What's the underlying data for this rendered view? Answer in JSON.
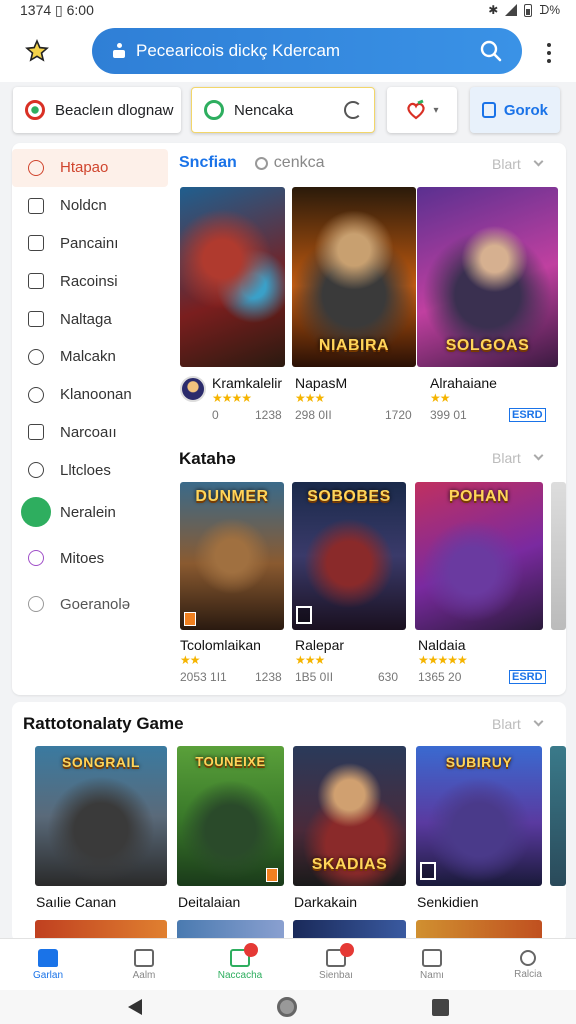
{
  "status_bar": {
    "time": "1374 ▯ 6:00",
    "battery": "ᗪ%"
  },
  "top_bar": {
    "search_query": "Pecearicois dickç Kdercam"
  },
  "chips": [
    {
      "label": "Beacleın dlognaw"
    },
    {
      "label": "Nencaka"
    },
    {
      "label": ""
    },
    {
      "label": "Gorok"
    }
  ],
  "sidebar": {
    "items": [
      {
        "label": "Htapao"
      },
      {
        "label": "Noldcn"
      },
      {
        "label": "Pancainı"
      },
      {
        "label": "Racoinsi"
      },
      {
        "label": "Naltaga"
      },
      {
        "label": "Malcakn"
      },
      {
        "label": "Klanoonan"
      },
      {
        "label": "Narcoaıı"
      },
      {
        "label": "Lltcloes"
      },
      {
        "label": "Neralein"
      },
      {
        "label": "Mitoes"
      },
      {
        "label": "Goeranolə"
      }
    ]
  },
  "section1": {
    "title": "Sncfian",
    "sub": "cenkca",
    "more": "Blart",
    "games": [
      {
        "name": "Kramkalelir",
        "stars": "★★★★",
        "meta_a": "0",
        "meta_b": "1238",
        "art_text": ""
      },
      {
        "name": "NapasM",
        "stars": "★★★",
        "meta_a": "298 0II",
        "meta_b": "1720",
        "art_text": "NIABIRA"
      },
      {
        "name": "Alrahaiane",
        "stars": "★★",
        "meta_a": "399 01",
        "esrb": "ESRD",
        "art_text": "SOLGOAS"
      }
    ]
  },
  "section2": {
    "title": "Katahə",
    "more": "Blart",
    "games": [
      {
        "name": "Tcolomlaikan",
        "stars": "★★",
        "meta_a": "2053 1I1",
        "meta_b": "1238",
        "art_text": "DUNMER"
      },
      {
        "name": "Ralepar",
        "stars": "★★★",
        "meta_a": "1B5 0II",
        "meta_b": "630",
        "art_text": "SOBOBES"
      },
      {
        "name": "Naldaia",
        "stars": "★★★★★",
        "meta_a": "1365 20",
        "esrb": "ESRD",
        "art_text": "POHAN"
      }
    ]
  },
  "section3": {
    "title": "Rattotonalaty Game",
    "more": "Blart",
    "games": [
      {
        "name": "Saılie Canan",
        "art_text": "SONGRAIL"
      },
      {
        "name": "Deitalaian",
        "art_text": "TOUNEIXE"
      },
      {
        "name": "Darkakain",
        "art_text": "SKADIAS"
      },
      {
        "name": "Senkidien",
        "art_text": "SUBIRUY"
      }
    ]
  },
  "bottom_nav": [
    {
      "label": "Garlan"
    },
    {
      "label": "Aalm"
    },
    {
      "label": "Naccacha"
    },
    {
      "label": "Sienbaı"
    },
    {
      "label": "Namı"
    },
    {
      "label": "Ralcia"
    }
  ],
  "colors": {
    "accent": "#1a73e8",
    "search_bg": "#2f7fd6",
    "active_nav": "#d0452e",
    "green": "#2eae5f",
    "star": "#f5b400"
  }
}
